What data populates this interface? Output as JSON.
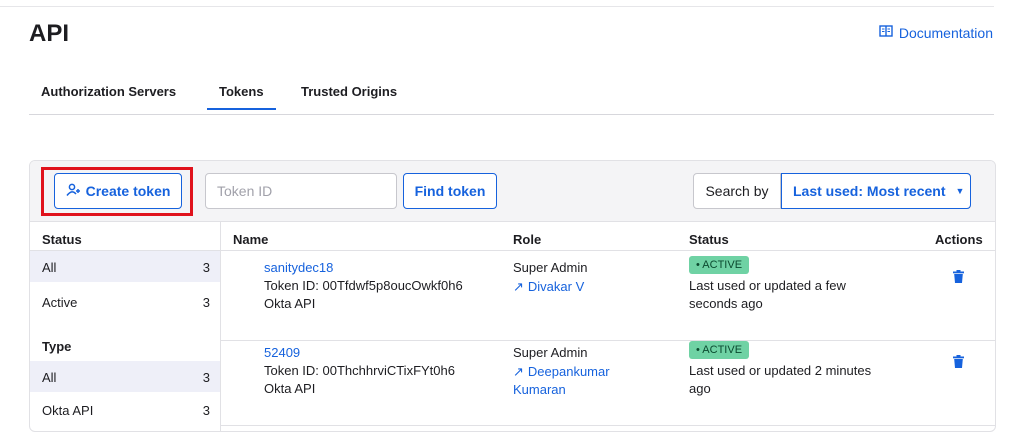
{
  "page": {
    "title": "API",
    "documentation_link": "Documentation"
  },
  "tabs": [
    {
      "label": "Authorization Servers",
      "active": false
    },
    {
      "label": "Tokens",
      "active": true
    },
    {
      "label": "Trusted Origins",
      "active": false
    }
  ],
  "toolbar": {
    "create_label": "Create token",
    "token_id_placeholder": "Token ID",
    "find_label": "Find token",
    "search_by_label": "Search by",
    "search_by_value": "Last used: Most recent"
  },
  "table": {
    "headers": {
      "status": "Status",
      "name": "Name",
      "role": "Role",
      "status2": "Status",
      "actions": "Actions"
    }
  },
  "filters": {
    "status_items": [
      {
        "label": "All",
        "count": "3"
      },
      {
        "label": "Active",
        "count": "3"
      }
    ],
    "type_heading": "Type",
    "type_items": [
      {
        "label": "All",
        "count": "3"
      },
      {
        "label": "Okta API",
        "count": "3"
      }
    ]
  },
  "tokens": [
    {
      "name": "sanitydec18",
      "token_id": "Token ID: 00Tfdwf5p8oucOwkf0h6",
      "type": "Okta API",
      "role": "Super Admin",
      "user": "Divakar V",
      "badge": "• ACTIVE",
      "last_used": "Last used or updated a few seconds ago"
    },
    {
      "name": "52409",
      "token_id": "Token ID: 00ThchhrviCTixFYt0h6",
      "type": "Okta API",
      "role": "Super Admin",
      "user": "Deepankumar Kumaran",
      "badge": "• ACTIVE",
      "last_used": "Last used or updated 2 minutes ago"
    }
  ],
  "colors": {
    "accent": "#1662dd",
    "active_badge": "#6fd2a4",
    "highlight": "#e0121c"
  }
}
